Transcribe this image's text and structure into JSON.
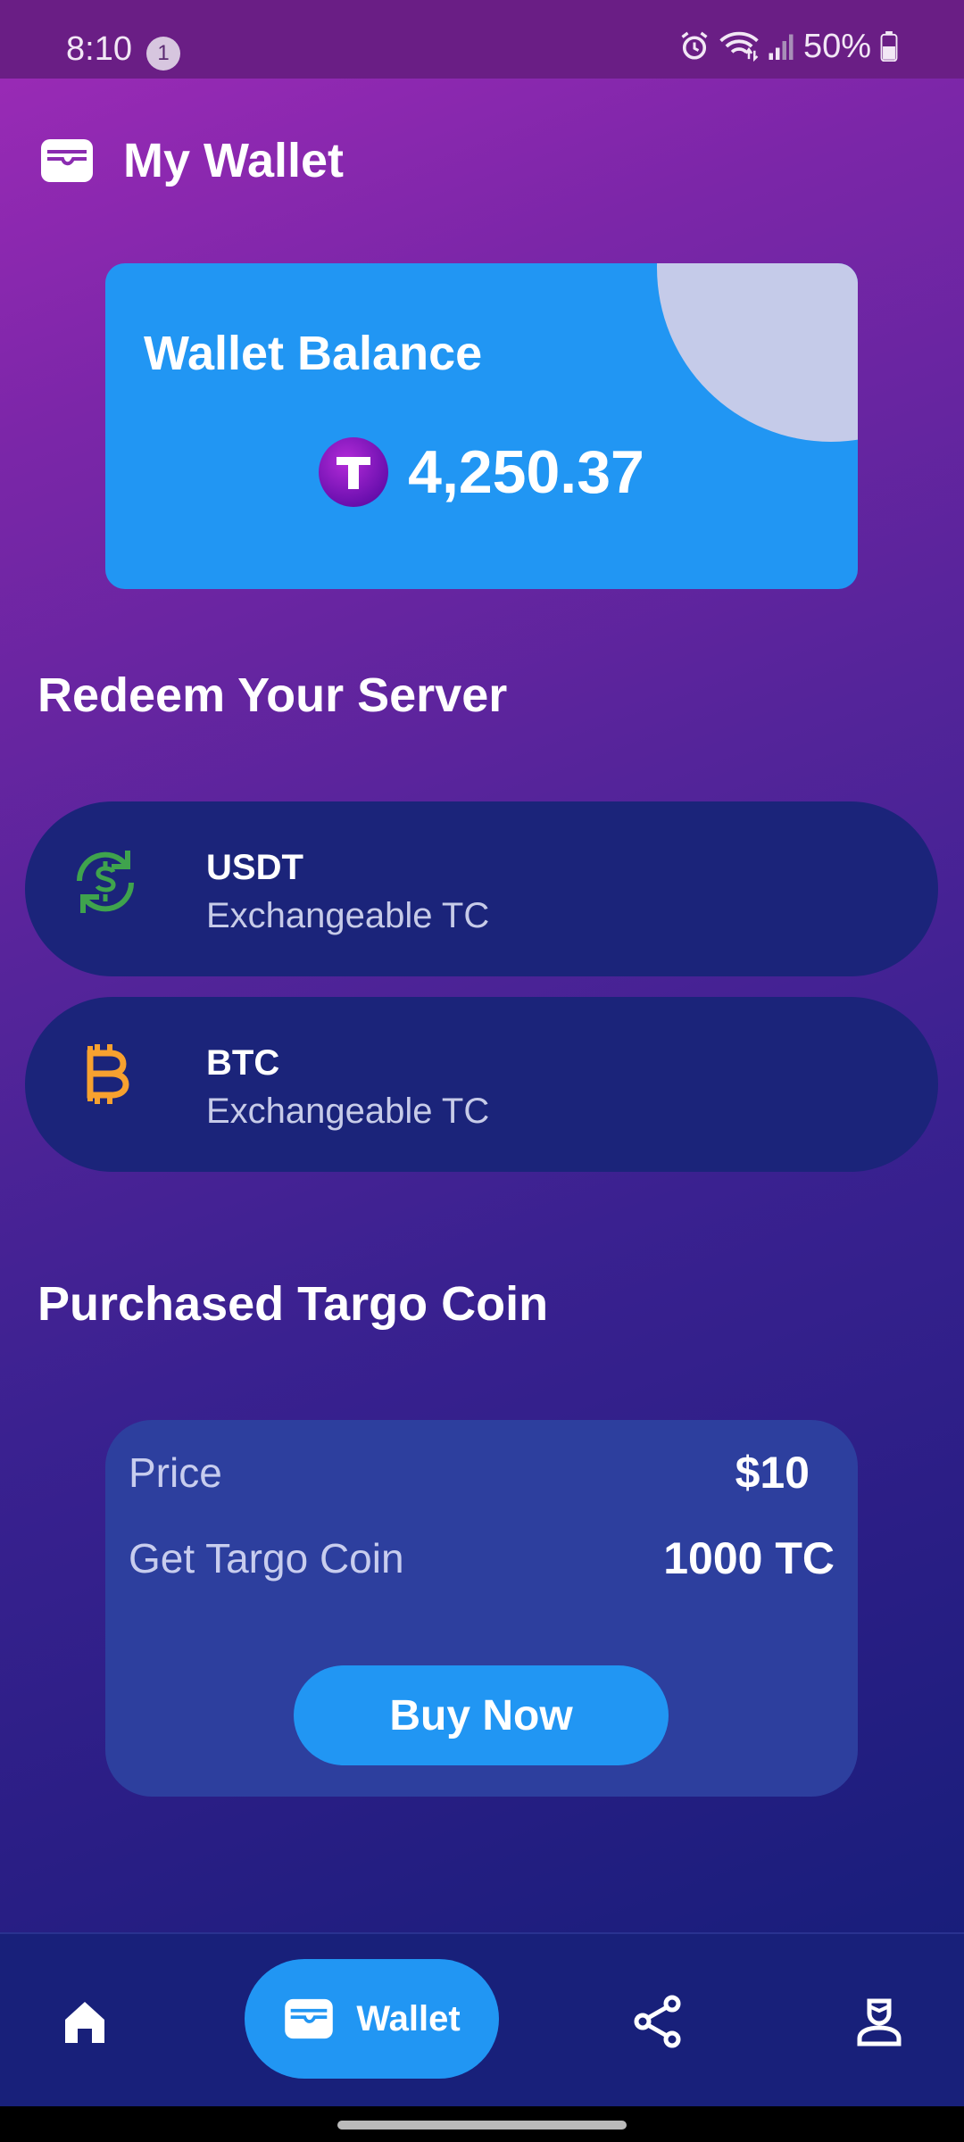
{
  "status_bar": {
    "time": "8:10",
    "notification_count": "1",
    "battery": "50%"
  },
  "header": {
    "title": "My Wallet"
  },
  "balance_card": {
    "title": "Wallet Balance",
    "coin_letter": "T",
    "amount": "4,250.37"
  },
  "redeem_section": {
    "title": "Redeem Your Server",
    "items": [
      {
        "name": "USDT",
        "subtitle": "Exchangeable TC",
        "icon": "currency-exchange-icon"
      },
      {
        "name": "BTC",
        "subtitle": "Exchangeable TC",
        "icon": "bitcoin-icon"
      }
    ]
  },
  "purchase_section": {
    "title": "Purchased Targo Coin",
    "price_label": "Price",
    "price_value": "$10",
    "get_label": "Get Targo Coin",
    "get_value": "1000 TC",
    "buy_button": "Buy Now"
  },
  "bottom_nav": {
    "items": [
      {
        "icon": "home-icon",
        "label": ""
      },
      {
        "icon": "wallet-icon",
        "label": "Wallet"
      },
      {
        "icon": "share-icon",
        "label": ""
      },
      {
        "icon": "profile-icon",
        "label": ""
      }
    ]
  },
  "colors": {
    "accent": "#2196f3",
    "card_dark": "#1b247a",
    "usdt_green": "#3fa34d",
    "btc_orange": "#f7a12f"
  }
}
